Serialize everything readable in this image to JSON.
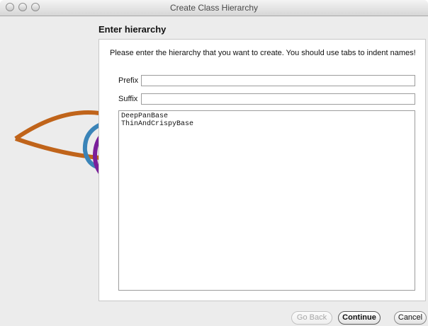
{
  "window": {
    "title": "Create Class Hierarchy"
  },
  "page": {
    "heading": "Enter hierarchy",
    "instruction": "Please enter the hierarchy that you want to create.  You should use tabs to indent names!"
  },
  "fields": {
    "prefix_label": "Prefix",
    "prefix_value": "",
    "suffix_label": "Suffix",
    "suffix_value": ""
  },
  "hierarchy": {
    "lines": [
      "DeepPanBase",
      "ThinAndCrispyBase"
    ]
  },
  "buttons": {
    "back": "Go Back",
    "continue": "Continue",
    "cancel": "Cancel"
  },
  "colors": {
    "logo_orange": "#c0641a",
    "logo_blue": "#3a84b8",
    "logo_purple": "#7a1f9a"
  }
}
